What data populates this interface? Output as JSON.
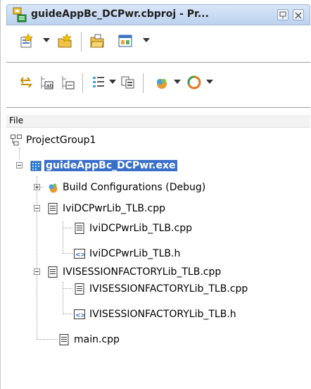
{
  "window": {
    "title": "guideAppBc_DCPwr.cbproj - Pr..."
  },
  "toolbar1": {
    "icons": [
      "new-item-icon",
      "add-file-icon",
      "open-project-icon",
      "view-form-icon"
    ]
  },
  "toolbar2": {
    "icons": [
      "sync-icon",
      "expand-icon",
      "collapse-icon",
      "list-icon",
      "build-icon",
      "options-icon",
      "refresh-icon"
    ]
  },
  "file_header": "File",
  "tree": {
    "group": "ProjectGroup1",
    "project": "guideAppBc_DCPwr.exe",
    "build_configurations": "Build Configurations (Debug)",
    "ividcp_cpp": "IviDCPwrLib_TLB.cpp",
    "ividcp_child_cpp": "IviDCPwrLib_TLB.cpp",
    "ividcp_child_h": "IviDCPwrLib_TLB.h",
    "ivisession_cpp": "IVISESSIONFACTORYLib_TLB.cpp",
    "ivisession_child_cpp": "IVISESSIONFACTORYLib_TLB.cpp",
    "ivisession_child_h": "IVISESSIONFACTORYLib_TLB.h",
    "main": "main.cpp"
  },
  "colors": {
    "selection": "#3a6fc9",
    "titlebar": "#bcd2ef"
  }
}
